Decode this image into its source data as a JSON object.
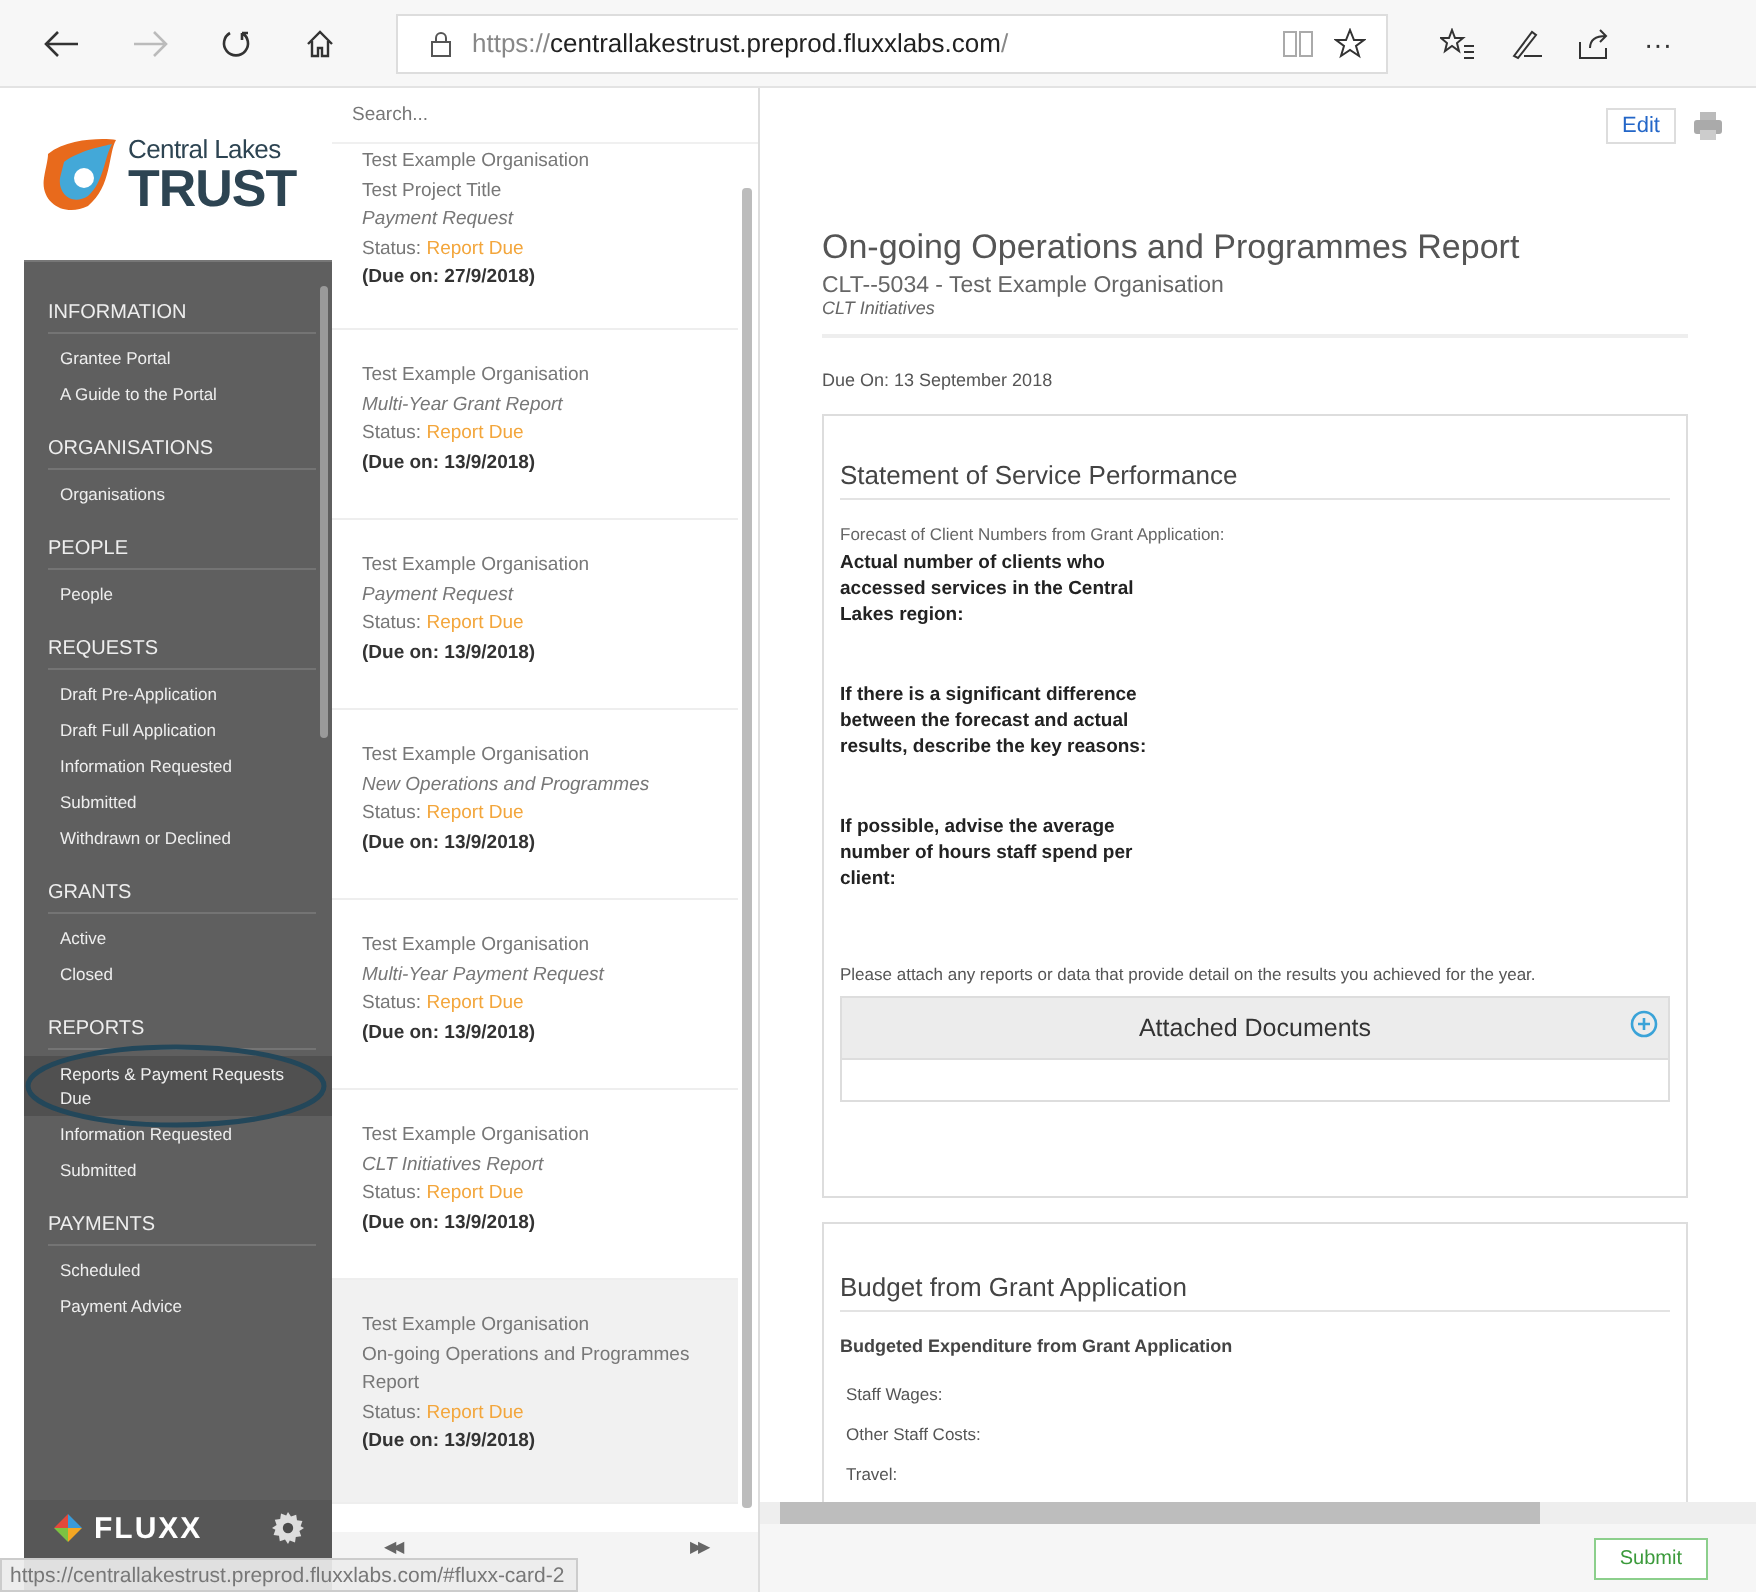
{
  "browser": {
    "url": {
      "scheme": "https://",
      "host": "centrallakestrust.preprod.fluxxlabs.com",
      "path": "/"
    },
    "forward_disabled": true,
    "more": "···"
  },
  "logo": {
    "line_1": "Central Lakes",
    "line_2": "TRUST"
  },
  "sidebar": {
    "sections": [
      {
        "heading": "INFORMATION",
        "items": [
          {
            "label": "Grantee Portal",
            "selected": false
          },
          {
            "label": "A Guide to the Portal",
            "selected": false
          }
        ]
      },
      {
        "heading": "ORGANISATIONS",
        "items": [
          {
            "label": "Organisations",
            "selected": false
          }
        ]
      },
      {
        "heading": "PEOPLE",
        "items": [
          {
            "label": "People",
            "selected": false
          }
        ]
      },
      {
        "heading": "REQUESTS",
        "items": [
          {
            "label": "Draft Pre-Application",
            "selected": false
          },
          {
            "label": "Draft Full Application",
            "selected": false
          },
          {
            "label": "Information Requested",
            "selected": false
          },
          {
            "label": "Submitted",
            "selected": false
          },
          {
            "label": "Withdrawn or Declined",
            "selected": false
          }
        ]
      },
      {
        "heading": "GRANTS",
        "items": [
          {
            "label": "Active",
            "selected": false
          },
          {
            "label": "Closed",
            "selected": false
          }
        ]
      },
      {
        "heading": "REPORTS",
        "items": [
          {
            "label": "Reports & Payment Requests Due",
            "selected": true
          },
          {
            "label": "Information Requested",
            "selected": false
          },
          {
            "label": "Submitted",
            "selected": false
          }
        ]
      },
      {
        "heading": "PAYMENTS",
        "items": [
          {
            "label": "Scheduled",
            "selected": false
          },
          {
            "label": "Payment Advice",
            "selected": false
          }
        ]
      }
    ],
    "brand": "FLUXX"
  },
  "list": {
    "search": {
      "placeholder": "Search..."
    },
    "cards": [
      {
        "organisation": "Test Example Organisation",
        "project": "Test Project Title",
        "type": "Payment Request",
        "type_italic": true,
        "status_label": "Status:",
        "status": "Report Due",
        "due": "(Due on: 27/9/2018)",
        "selected": false
      },
      {
        "organisation": "Test Example Organisation",
        "type": "Multi-Year Grant Report",
        "type_italic": true,
        "status_label": "Status:",
        "status": "Report Due",
        "due": "(Due on: 13/9/2018)",
        "selected": false
      },
      {
        "organisation": "Test Example Organisation",
        "type": "Payment Request",
        "type_italic": true,
        "status_label": "Status:",
        "status": "Report Due",
        "due": "(Due on: 13/9/2018)",
        "selected": false
      },
      {
        "organisation": "Test Example Organisation",
        "type": "New Operations and Programmes",
        "type_italic": true,
        "status_label": "Status:",
        "status": "Report Due",
        "due": "(Due on: 13/9/2018)",
        "selected": false
      },
      {
        "organisation": "Test Example Organisation",
        "type": "Multi-Year Payment Request",
        "type_italic": true,
        "status_label": "Status:",
        "status": "Report Due",
        "due": "(Due on: 13/9/2018)",
        "selected": false
      },
      {
        "organisation": "Test Example Organisation",
        "type": "CLT Initiatives Report",
        "type_italic": true,
        "status_label": "Status:",
        "status": "Report Due",
        "due": "(Due on: 13/9/2018)",
        "selected": false
      },
      {
        "organisation": "Test Example Organisation",
        "type": "On-going Operations and Programmes Report",
        "type_italic": false,
        "status_label": "Status:",
        "status": "Report Due",
        "due": "(Due on: 13/9/2018)",
        "selected": true
      }
    ],
    "pager": {
      "previous": "◀◀",
      "next": "▶▶"
    }
  },
  "status_url": "https://centrallakestrust.preprod.fluxxlabs.com/#fluxx-card-2",
  "detail": {
    "edit": "Edit",
    "title": "On-going Operations and Programmes Report",
    "subtitle": "CLT--5034 - Test Example Organisation",
    "program": "CLT Initiatives",
    "due": "Due On: 13 September 2018",
    "sections": [
      {
        "kind": "performance",
        "heading": "Statement of Service Performance",
        "forecast_label": "Forecast of Client Numbers from Grant Application:",
        "questions": [
          "Actual number of clients who accessed services in the Central Lakes region:",
          "If there is a significant difference between the forecast and actual results, describe the key reasons:",
          "If possible, advise the average number of hours staff spend per client:"
        ],
        "attach_note": "Please attach any reports or data that provide detail on the results you achieved for the year.",
        "attachments_title": "Attached Documents"
      },
      {
        "kind": "budget",
        "heading": "Budget from Grant Application",
        "subheading": "Budgeted Expenditure from Grant Application",
        "fields": [
          "Staff Wages:",
          "Other Staff Costs:",
          "Travel:"
        ]
      }
    ],
    "submit": "Submit"
  }
}
